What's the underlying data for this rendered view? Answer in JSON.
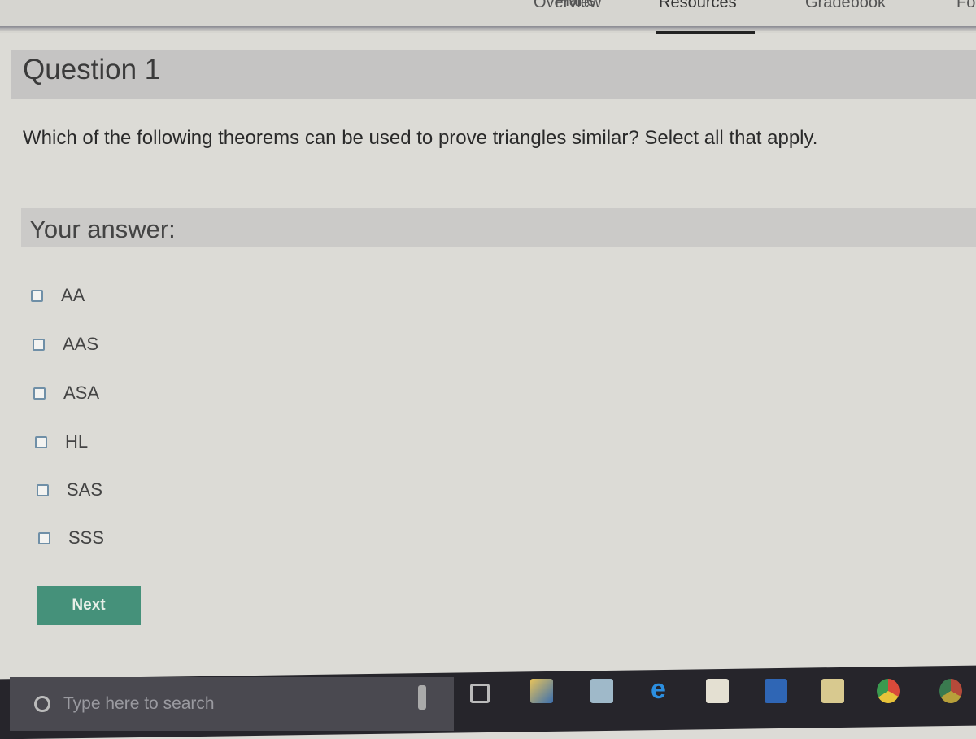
{
  "nav": {
    "items": [
      "Overview",
      "Plans",
      "Resources",
      "Gradebook",
      "Fo"
    ],
    "active": "Resources"
  },
  "question": {
    "title": "Question 1",
    "text": "Which of the following theorems can be used to prove triangles similar? Select all that apply."
  },
  "answer": {
    "label": "Your answer:",
    "options": [
      {
        "label": "AA",
        "checked": false
      },
      {
        "label": "AAS",
        "checked": false
      },
      {
        "label": "ASA",
        "checked": false
      },
      {
        "label": "HL",
        "checked": false
      },
      {
        "label": "SAS",
        "checked": false
      },
      {
        "label": "SSS",
        "checked": false
      }
    ]
  },
  "next_label": "Next",
  "taskbar": {
    "search_placeholder": "Type here to search",
    "icons": [
      "microphone-icon",
      "task-view-icon",
      "app-icon",
      "calculator-icon",
      "edge-icon",
      "store-icon",
      "word-icon",
      "file-explorer-icon",
      "chrome-icon",
      "chrome-icon"
    ]
  },
  "colors": {
    "accent": "#45917a",
    "taskbar": "#26252b"
  }
}
